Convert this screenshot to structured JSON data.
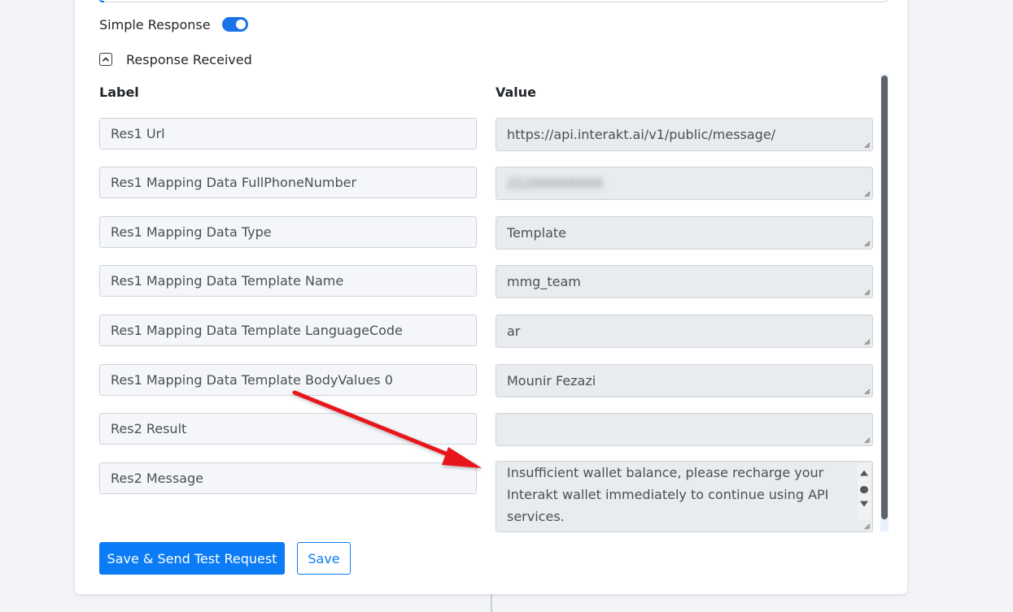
{
  "toggle": {
    "label": "Simple Response",
    "on": true
  },
  "section": {
    "title": "Response Received",
    "icon": "chevron-up-icon"
  },
  "table": {
    "label_header": "Label",
    "value_header": "Value",
    "rows": [
      {
        "label": "Res1 Url",
        "value": "https://api.interakt.ai/v1/public/message/"
      },
      {
        "label": "Res1 Mapping Data FullPhoneNumber",
        "value": "212XXXXXXXX"
      },
      {
        "label": "Res1 Mapping Data Type",
        "value": "Template"
      },
      {
        "label": "Res1 Mapping Data Template Name",
        "value": "mmg_team"
      },
      {
        "label": "Res1 Mapping Data Template LanguageCode",
        "value": "ar"
      },
      {
        "label": "Res1 Mapping Data Template BodyValues 0",
        "value": "Mounir Fezazi"
      },
      {
        "label": "Res2 Result",
        "value": ""
      },
      {
        "label": "Res2 Message",
        "value": "Insufficient wallet balance, please recharge your Interakt wallet immediately to continue using API services."
      }
    ]
  },
  "buttons": {
    "save_send": "Save & Send Test Request",
    "save": "Save"
  },
  "colors": {
    "primary": "#0b7cf5",
    "arrow": "#e8141c"
  }
}
